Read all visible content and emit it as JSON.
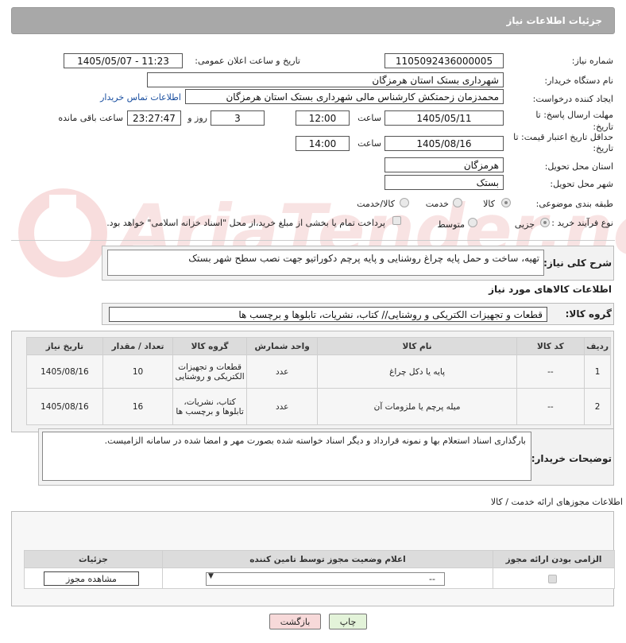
{
  "header": {
    "title": "جزئیات اطلاعات نیاز"
  },
  "form": {
    "need_number_label": "شماره نیاز:",
    "need_number": "1105092436000005",
    "announce_label": "تاریخ و ساعت اعلان عمومی:",
    "announce_value": "1405/05/07 - 11:23",
    "buyer_org_label": "نام دستگاه خریدار:",
    "buyer_org": "شهرداری بستک استان هرمزگان",
    "creator_label": "ایجاد کننده درخواست:",
    "creator": "محمدزمان زحمتکش کارشناس مالی شهرداری بستک استان هرمزگان",
    "contact_link": "اطلاعات تماس خریدار",
    "deadline_label": "مهلت ارسال پاسخ: تا تاریخ:",
    "deadline_date": "1405/05/11",
    "hour_label": "ساعت",
    "deadline_time": "12:00",
    "days": "3",
    "days_suffix": "روز و",
    "remaining": "23:27:47",
    "remaining_suffix": "ساعت باقی مانده",
    "validity_label": "حداقل تاریخ اعتبار قیمت: تا تاریخ:",
    "validity_date": "1405/08/16",
    "validity_time": "14:00",
    "province_label": "استان محل تحویل:",
    "province": "هرمزگان",
    "city_label": "شهر محل تحویل:",
    "city": "بستک",
    "category_label": "طبقه بندی موضوعی:",
    "cat_goods": "کالا",
    "cat_service": "خدمت",
    "cat_both": "کالا/خدمت",
    "process_label": "نوع فرآیند خرید :",
    "proc_partial": "جزیی",
    "proc_medium": "متوسط",
    "payment_note": "پرداخت تمام یا بخشی از مبلغ خرید،از محل \"اسناد خزانه اسلامی\" خواهد بود."
  },
  "description": {
    "label": "شرح کلی نیاز:",
    "text": "تهیه، ساخت و حمل پایه  چراغ روشنایی و پایه پرچم دکوراتیو جهت نصب سطح شهر بستک"
  },
  "goods": {
    "section_title": "اطلاعات کالاهای مورد نیاز",
    "group_label": "گروه کالا:",
    "group_value": "قطعات و تجهیزات الکتریکی و روشنایی// کتاب، نشریات، تابلوها و برچسب ها",
    "columns": [
      "ردیف",
      "کد کالا",
      "نام کالا",
      "واحد شمارش",
      "گروه کالا",
      "تعداد / مقدار",
      "تاریخ نیاز"
    ],
    "rows": [
      {
        "row": "1",
        "code": "--",
        "name": "پایه یا دکل چراغ",
        "unit": "عدد",
        "group": "قطعات و تجهیزات الکتریکی و روشنایی",
        "qty": "10",
        "date": "1405/08/16"
      },
      {
        "row": "2",
        "code": "--",
        "name": "میله پرچم یا ملزومات آن",
        "unit": "عدد",
        "group": "کتاب، نشریات، تابلوها و برچسب ها",
        "qty": "16",
        "date": "1405/08/16"
      }
    ]
  },
  "buyer_notes": {
    "label": "توضیحات خریدار:",
    "text": "بارگذاری اسناد استعلام بها و نمونه قرارداد و دیگر اسناد خواسته شده بصورت مهر و امضا شده در سامانه الزامیست."
  },
  "permits": {
    "section_title": "اطلاعات مجوزهای ارائه خدمت / کالا",
    "columns": [
      "الزامی بودن ارائه مجوز",
      "اعلام وضعیت مجوز توسط تامین کننده",
      "جزئیات"
    ],
    "select_value": "--",
    "view_button": "مشاهده مجوز"
  },
  "footer": {
    "print_button": "چاپ",
    "back_button": "بازگشت"
  },
  "watermark": "AriaTender.net",
  "colors": {
    "header_bg": "#a8a8a8",
    "link": "#1a4fa0",
    "back_btn": "#f7d9d9",
    "print_btn": "#e3f3d9"
  }
}
